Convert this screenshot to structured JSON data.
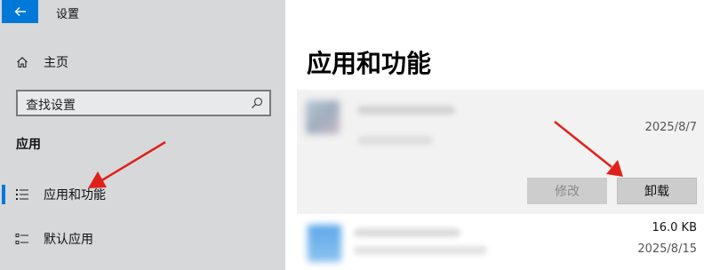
{
  "window": {
    "title": "设置"
  },
  "sidebar": {
    "home_label": "主页",
    "search_placeholder": "查找设置",
    "section_title": "应用",
    "items": [
      {
        "label": "应用和功能",
        "active": true
      },
      {
        "label": "默认应用",
        "active": false
      }
    ]
  },
  "main": {
    "page_title": "应用和功能",
    "apps": [
      {
        "date": "2025/8/7",
        "expanded": true,
        "modify_label": "修改",
        "uninstall_label": "卸载"
      },
      {
        "size": "16.0 KB",
        "date": "2025/8/15",
        "expanded": false
      }
    ]
  },
  "colors": {
    "accent": "#0078d7",
    "annotation_arrow": "#e0201a"
  }
}
